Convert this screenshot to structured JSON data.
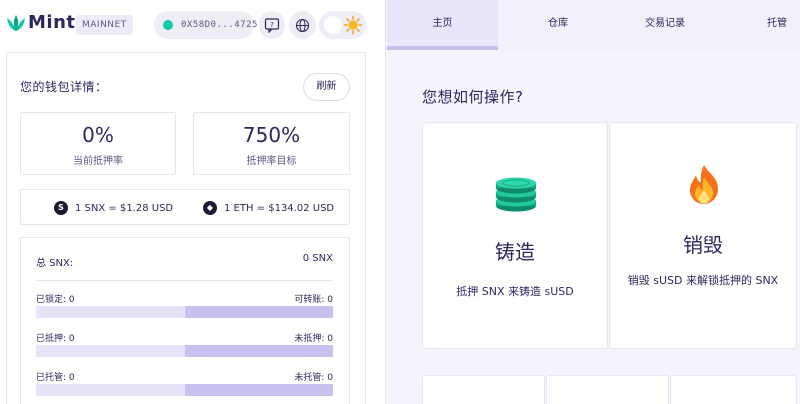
{
  "brand": {
    "name": "Mintr",
    "network": "MAINNET"
  },
  "header": {
    "address": "0X58D0...4725"
  },
  "wallet": {
    "title": "您的钱包详情：",
    "refresh_label": "刷新",
    "current_ratio": {
      "value": "0%",
      "label": "当前抵押率"
    },
    "target_ratio": {
      "value": "750%",
      "label": "抵押率目标"
    },
    "prices": {
      "snx": {
        "icon": "S",
        "text": "1 SNX = $1.28 USD"
      },
      "eth": {
        "icon": "◆",
        "text": "1 ETH = $134.02 USD"
      }
    },
    "balances": {
      "total_label": "总 SNX:",
      "total_value": "0 SNX",
      "locked": {
        "left": "已锁定: 0",
        "right": "可转账: 0",
        "fraction": 0.5
      },
      "staked": {
        "left": "已抵押: 0",
        "right": "未抵押: 0",
        "fraction": 0.5
      },
      "escrowed": {
        "left": "已托管: 0",
        "right": "未托管: 0",
        "fraction": 0.5
      }
    }
  },
  "tabs": [
    {
      "label": "主页"
    },
    {
      "label": "仓库"
    },
    {
      "label": "交易记录"
    },
    {
      "label": "托管"
    }
  ],
  "main": {
    "question": "您想如何操作?",
    "mint": {
      "title": "铸造",
      "desc": "抵押 SNX 来铸造 sUSD",
      "icon": "coins-icon"
    },
    "burn": {
      "title": "销毁",
      "desc": "销毁 sUSD 来解锁抵押的 SNX",
      "icon": "fire-icon"
    }
  },
  "colors": {
    "accent": "#c8c0ef",
    "accent_light": "#e7e3f9",
    "status_green": "#14c8a8",
    "text": "#2e2660"
  }
}
